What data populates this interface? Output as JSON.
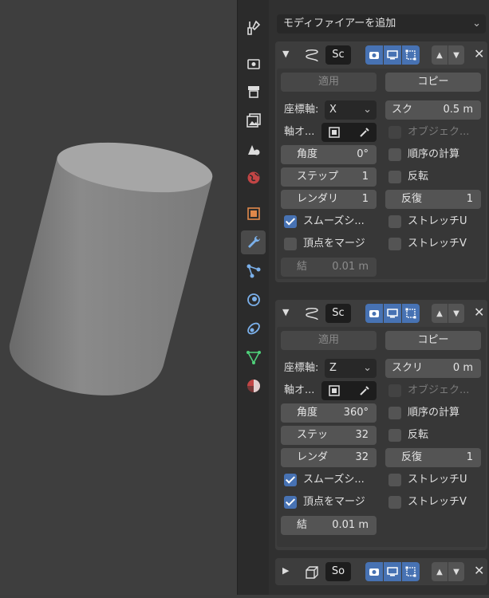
{
  "viewport": {
    "object": "cylinder"
  },
  "tabs": [
    {
      "name": "tool-tab",
      "icon": "tool-icon"
    },
    {
      "name": "render-tab",
      "icon": "render-icon"
    },
    {
      "name": "output-tab",
      "icon": "output-icon"
    },
    {
      "name": "view-layer-tab",
      "icon": "view-layer-icon"
    },
    {
      "name": "scene-tab",
      "icon": "scene-icon"
    },
    {
      "name": "world-tab",
      "icon": "world-icon"
    },
    {
      "name": "object-tab",
      "icon": "object-icon"
    },
    {
      "name": "modifier-tab",
      "icon": "wrench-icon",
      "active": true
    },
    {
      "name": "particles-tab",
      "icon": "particles-icon"
    },
    {
      "name": "physics-tab",
      "icon": "physics-icon"
    },
    {
      "name": "constraints-tab",
      "icon": "constraints-icon"
    },
    {
      "name": "data-tab",
      "icon": "mesh-data-icon"
    },
    {
      "name": "material-tab",
      "icon": "material-icon"
    }
  ],
  "add_modifier": "モディファイアーを追加",
  "modifiers": [
    {
      "name": "Sc",
      "apply": "適用",
      "copy": "コピー",
      "axis_label": "座標軸:",
      "axis_value": "X",
      "screw_label": "スク",
      "screw_value": "0.5 m",
      "axis_object_label": "軸オ...",
      "object_screw_label": "オブジェク...",
      "angle_label": "角度",
      "angle_value": "0°",
      "calc_order_label": "順序の計算",
      "steps_label": "ステップ",
      "steps_value": "1",
      "flip_label": "反転",
      "render_label": "レンダリ",
      "render_value": "1",
      "iterations_label": "反復",
      "iterations_value": "1",
      "smooth_label": "スムーズシ...",
      "smooth_on": true,
      "stretch_u_label": "ストレッチU",
      "merge_label": "頂点をマージ",
      "merge_on": false,
      "stretch_v_label": "ストレッチV",
      "dist_label": "結",
      "dist_value": "0.01 m"
    },
    {
      "name": "Sc",
      "apply": "適用",
      "copy": "コピー",
      "axis_label": "座標軸:",
      "axis_value": "Z",
      "screw_label": "スクリ",
      "screw_value": "0 m",
      "axis_object_label": "軸オ...",
      "object_screw_label": "オブジェク...",
      "angle_label": "角度",
      "angle_value": "360°",
      "calc_order_label": "順序の計算",
      "steps_label": "ステッ",
      "steps_value": "32",
      "flip_label": "反転",
      "render_label": "レンダ",
      "render_value": "32",
      "iterations_label": "反復",
      "iterations_value": "1",
      "smooth_label": "スムーズシ...",
      "smooth_on": true,
      "stretch_u_label": "ストレッチU",
      "merge_label": "頂点をマージ",
      "merge_on": true,
      "stretch_v_label": "ストレッチV",
      "dist_label": "結",
      "dist_value": "0.01 m"
    }
  ],
  "collapsed_modifier": {
    "name": "So"
  },
  "colors": {
    "accent": "#4772b3",
    "panel": "#3d3d3d",
    "field": "#545454"
  }
}
